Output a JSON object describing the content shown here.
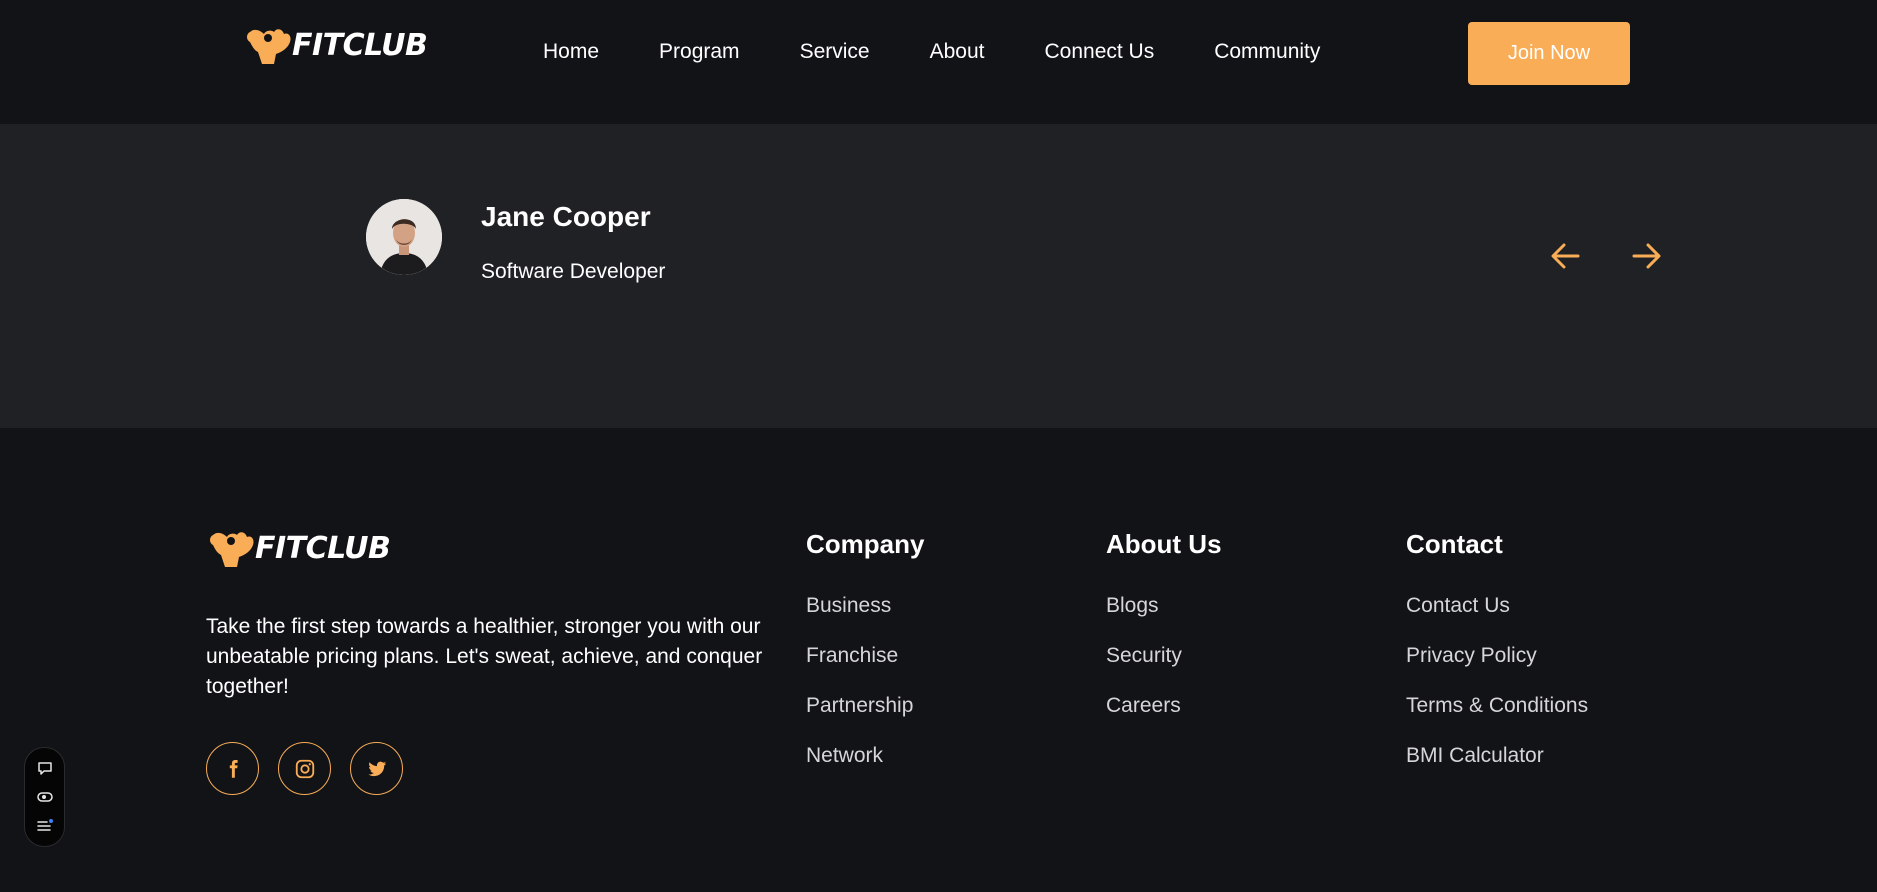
{
  "brand": {
    "name": "FITCLUB",
    "accent": "#f8ad56"
  },
  "nav": {
    "items": [
      "Home",
      "Program",
      "Service",
      "About",
      "Connect Us",
      "Community"
    ],
    "cta": "Join Now"
  },
  "testimonial": {
    "name": "Jane Cooper",
    "role": "Software Developer",
    "prev_icon": "arrow-left-icon",
    "next_icon": "arrow-right-icon"
  },
  "footer": {
    "tagline": "Take the first step towards a healthier, stronger you with our unbeatable pricing plans. Let's sweat, achieve, and conquer together!",
    "social": [
      "facebook-icon",
      "instagram-icon",
      "twitter-icon"
    ],
    "columns": [
      {
        "title": "Company",
        "links": [
          "Business",
          "Franchise",
          "Partnership",
          "Network"
        ]
      },
      {
        "title": "About Us",
        "links": [
          "Blogs",
          "Security",
          "Careers"
        ]
      },
      {
        "title": "Contact",
        "links": [
          "Contact Us",
          "Privacy Policy",
          "Terms & Conditions",
          "BMI Calculator"
        ]
      }
    ]
  },
  "widget": {
    "icons": [
      "comment-icon",
      "eye-icon",
      "list-icon"
    ]
  }
}
